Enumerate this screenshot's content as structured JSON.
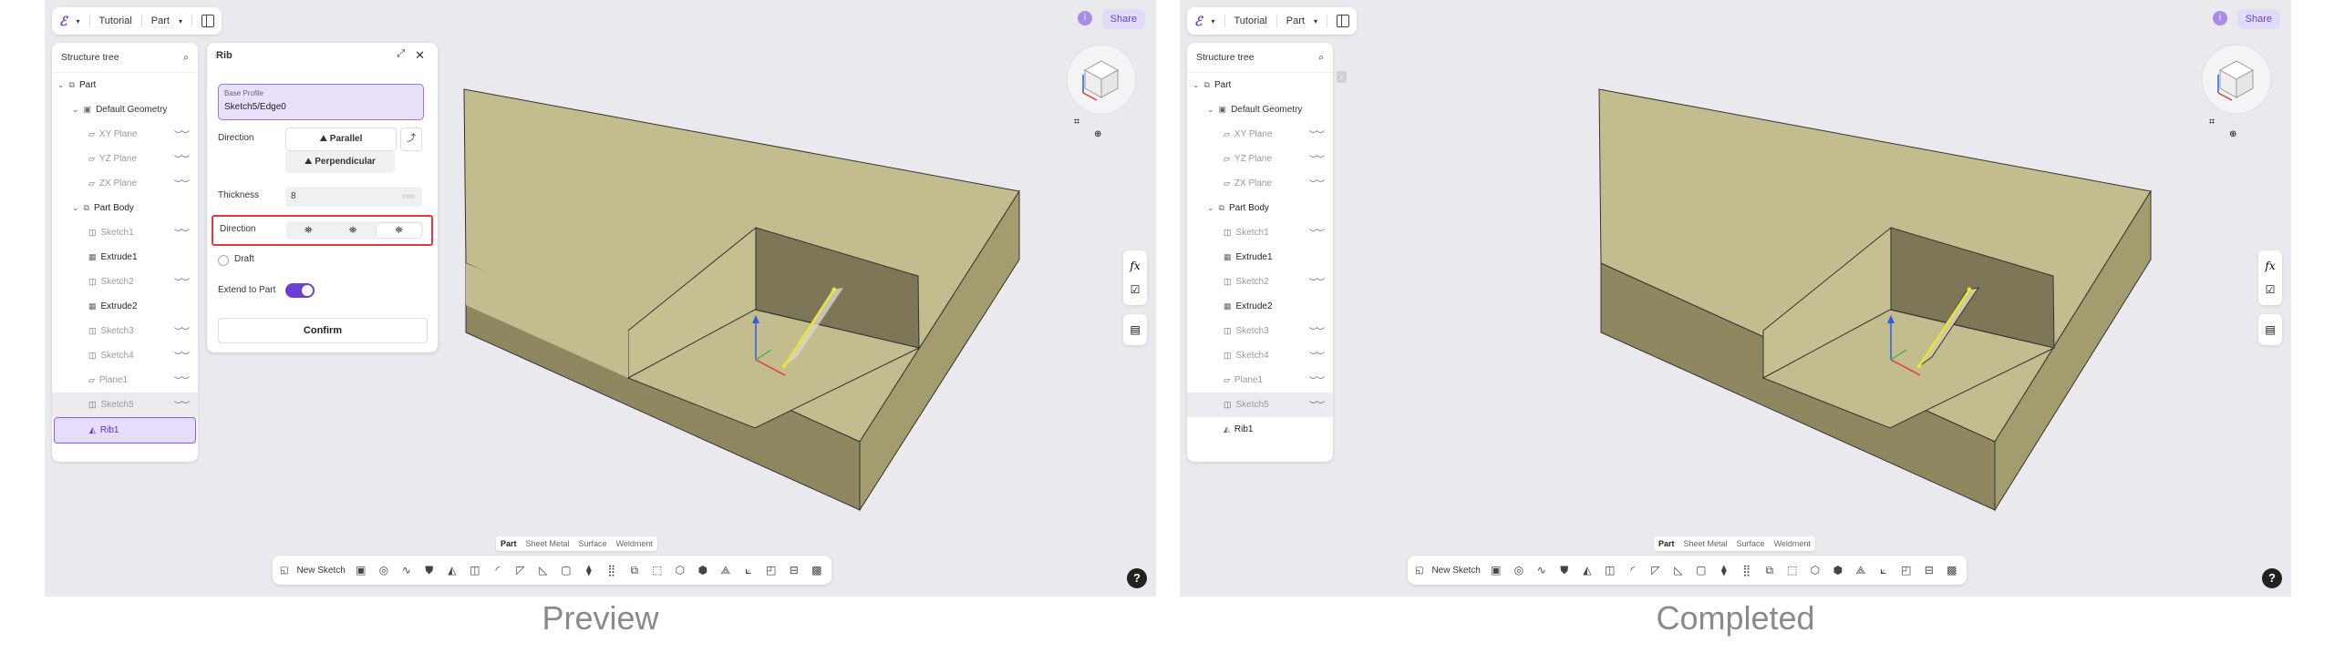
{
  "left": {
    "caption": "Preview",
    "topbar": {
      "logo": "ℰ",
      "tutorial": "Tutorial",
      "part": "Part",
      "share": "Share",
      "info": "i"
    },
    "tree": {
      "title": "Structure tree",
      "items": [
        {
          "label": "Part",
          "icon": "part-icon"
        },
        {
          "label": "Default Geometry"
        },
        {
          "label": "XY Plane"
        },
        {
          "label": "YZ Plane"
        },
        {
          "label": "ZX Plane"
        },
        {
          "label": "Part Body"
        },
        {
          "label": "Sketch1"
        },
        {
          "label": "Extrude1"
        },
        {
          "label": "Sketch2"
        },
        {
          "label": "Extrude2"
        },
        {
          "label": "Sketch3"
        },
        {
          "label": "Sketch4"
        },
        {
          "label": "Plane1"
        },
        {
          "label": "Sketch5"
        },
        {
          "label": "Rib1"
        }
      ]
    },
    "rib": {
      "title": "Rib",
      "base_profile_label": "Base Profile",
      "base_profile_value": "Sketch5/Edge0",
      "direction_label": "Direction",
      "parallel": "Parallel",
      "perpendicular": "Perpendicular",
      "thickness_label": "Thickness",
      "thickness_value": "8",
      "thickness_unit": "mm",
      "direction2_label": "Direction",
      "draft_label": "Draft",
      "extend_label": "Extend to Part",
      "confirm": "Confirm"
    },
    "tabs": [
      "Part",
      "Sheet Metal",
      "Surface",
      "Weldment"
    ],
    "toolbar": {
      "new_sketch": "New Sketch"
    },
    "side": {
      "fx": "fx"
    },
    "help": "?"
  },
  "right": {
    "caption": "Completed",
    "topbar": {
      "logo": "ℰ",
      "tutorial": "Tutorial",
      "part": "Part",
      "share": "Share",
      "info": "i"
    },
    "tree": {
      "title": "Structure tree",
      "items": [
        {
          "label": "Part"
        },
        {
          "label": "Default Geometry"
        },
        {
          "label": "XY Plane"
        },
        {
          "label": "YZ Plane"
        },
        {
          "label": "ZX Plane"
        },
        {
          "label": "Part Body"
        },
        {
          "label": "Sketch1"
        },
        {
          "label": "Extrude1"
        },
        {
          "label": "Sketch2"
        },
        {
          "label": "Extrude2"
        },
        {
          "label": "Sketch3"
        },
        {
          "label": "Sketch4"
        },
        {
          "label": "Plane1"
        },
        {
          "label": "Sketch5"
        },
        {
          "label": "Rib1"
        }
      ]
    },
    "tabs": [
      "Part",
      "Sheet Metal",
      "Surface",
      "Weldment"
    ],
    "toolbar": {
      "new_sketch": "New Sketch"
    },
    "side": {
      "fx": "fx"
    },
    "help": "?"
  },
  "colors": {
    "accent": "#6b3fd6",
    "highlight_border": "#e23a3a",
    "model_top": "#c2bc8e",
    "model_left": "#8e8760",
    "model_right": "#a29c6e"
  }
}
